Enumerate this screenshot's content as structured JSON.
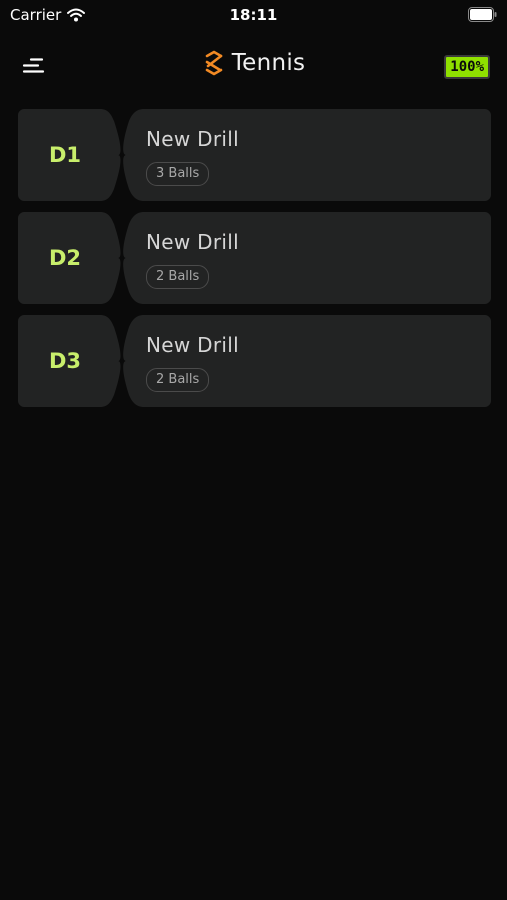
{
  "status_bar": {
    "carrier": "Carrier",
    "time": "18:11",
    "icons": [
      "wifi-icon",
      "battery-icon"
    ]
  },
  "nav": {
    "menu_icon": "menu-icon",
    "logo_icon": "tennis-logo-icon",
    "title": "Tennis",
    "battery_label": "100%"
  },
  "colors": {
    "background": "#0a0a0a",
    "card": "#222323",
    "accent_green": "#c8ee6b",
    "battery_green": "#8fe000",
    "logo_orange": "#f28a24"
  },
  "drills": [
    {
      "id": "D1",
      "name": "New Drill",
      "balls": "3 Balls"
    },
    {
      "id": "D2",
      "name": "New Drill",
      "balls": "2 Balls"
    },
    {
      "id": "D3",
      "name": "New Drill",
      "balls": "2 Balls"
    }
  ]
}
